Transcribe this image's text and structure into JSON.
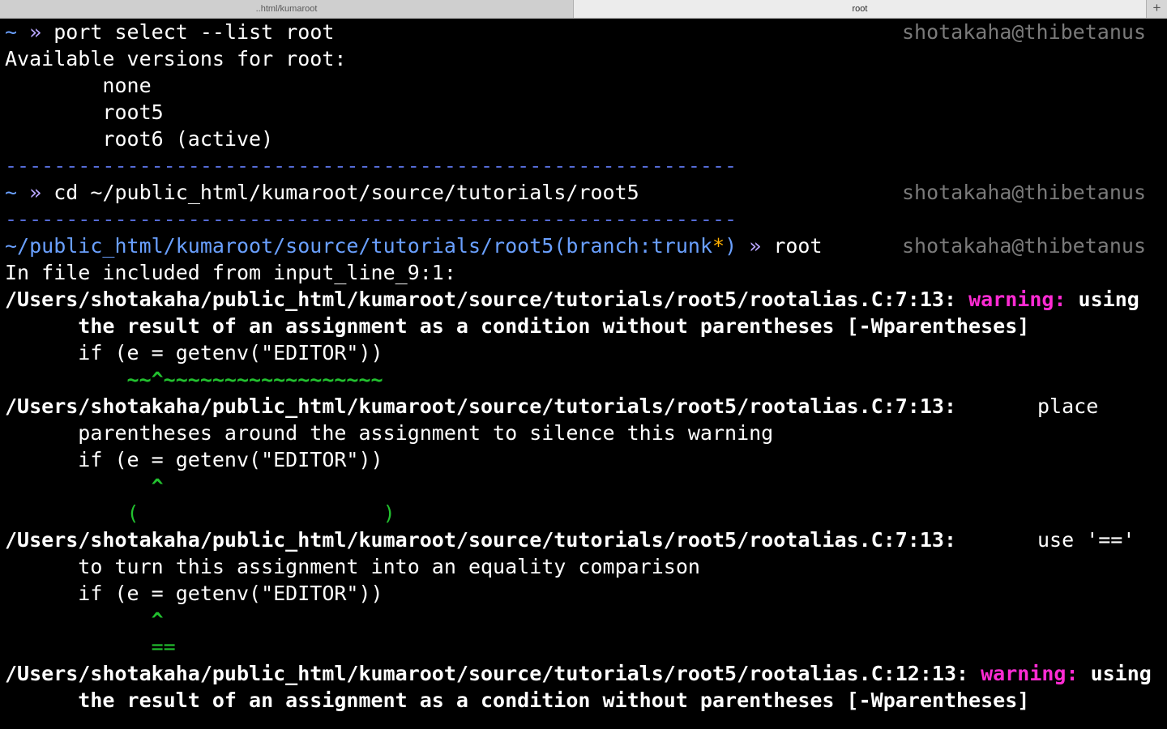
{
  "tabs": [
    {
      "label": "..html/kumaroot",
      "active": false
    },
    {
      "label": "root",
      "active": true
    }
  ],
  "new_tab_glyph": "+",
  "prompt": {
    "tilde": "~",
    "arrow": "»",
    "user_host": "shotakaha@thibetanus",
    "separator": "------------------------------------------------------------"
  },
  "lines": {
    "l1_cmd": "port select --list root",
    "l2": "Available versions for root:",
    "l3": "        none",
    "l4": "        root5",
    "l5": "        root6 (active)",
    "l7_cmd": "cd ~/public_html/kumaroot/source/tutorials/root5",
    "l9_path": "~/public_html/kumaroot/source/tutorials/root5",
    "l9_branch_open": "(branch:",
    "l9_branch": "trunk",
    "l9_star": "*",
    "l9_branch_close": ")",
    "l9_cmd": "root",
    "l10": "In file included from input_line_9:1:",
    "l11_path": "/Users/shotakaha/public_html/kumaroot/source/tutorials/root5/rootalias.C:7:13: ",
    "l11_warn": "warning:",
    "l11_rest": " using",
    "l12": "      the result of an assignment as a condition without parentheses [-Wparentheses]",
    "l13": "      if (e = getenv(\"EDITOR\"))",
    "l14": "          ~~^~~~~~~~~~~~~~~~~~~",
    "l15_path": "/Users/shotakaha/public_html/kumaroot/source/tutorials/root5/rootalias.C:7:13:",
    "l15_note": "place",
    "l16": "      parentheses around the assignment to silence this warning",
    "l17": "      if (e = getenv(\"EDITOR\"))",
    "l18": "            ^",
    "l19": "          (                    )",
    "l20_path": "/Users/shotakaha/public_html/kumaroot/source/tutorials/root5/rootalias.C:7:13:",
    "l20_note": "use '=='",
    "l21": "      to turn this assignment into an equality comparison",
    "l22": "      if (e = getenv(\"EDITOR\"))",
    "l23": "            ^",
    "l24": "            ==",
    "l25_path": "/Users/shotakaha/public_html/kumaroot/source/tutorials/root5/rootalias.C:12:13: ",
    "l25_warn": "warning:",
    "l25_rest": " using",
    "l26": "      the result of an assignment as a condition without parentheses [-Wparentheses]"
  },
  "colors": {
    "background": "#000000",
    "prompt_blue": "#6aa0ff",
    "separator_blue": "#556bd6",
    "arrow_purple": "#b9a6ff",
    "branch_star_orange": "#ffb000",
    "warning_magenta": "#ff2bd3",
    "fixit_green": "#22c12f",
    "user_host_gray": "#7a7a7a"
  }
}
